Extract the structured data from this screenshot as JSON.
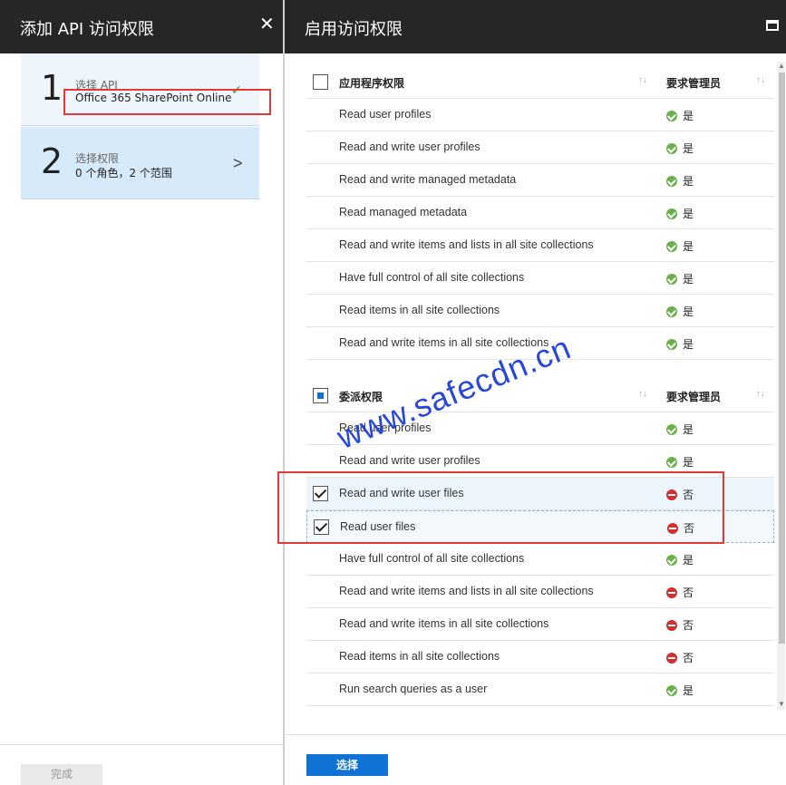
{
  "left_blade": {
    "title": "添加 API 访问权限",
    "close_icon": "close-icon",
    "steps": [
      {
        "number": "1",
        "label": "选择 API",
        "sub": "Office 365 SharePoint Online",
        "state": "completed"
      },
      {
        "number": "2",
        "label": "选择权限",
        "sub": "0 个角色，2 个范围",
        "state": "active"
      }
    ],
    "done_label": "完成"
  },
  "right_blade": {
    "title": "启用访问权限",
    "admin_header": "要求管理员",
    "app_group": {
      "name": "应用程序权限",
      "rows": [
        {
          "label": "Read user profiles",
          "admin": "是",
          "status": "yes"
        },
        {
          "label": "Read and write user profiles",
          "admin": "是",
          "status": "yes"
        },
        {
          "label": "Read and write managed metadata",
          "admin": "是",
          "status": "yes"
        },
        {
          "label": "Read managed metadata",
          "admin": "是",
          "status": "yes"
        },
        {
          "label": "Read and write items and lists in all site collections",
          "admin": "是",
          "status": "yes"
        },
        {
          "label": "Have full control of all site collections",
          "admin": "是",
          "status": "yes"
        },
        {
          "label": "Read items in all site collections",
          "admin": "是",
          "status": "yes"
        },
        {
          "label": "Read and write items in all site collections",
          "admin": "是",
          "status": "yes"
        }
      ]
    },
    "delegated_group": {
      "name": "委派权限",
      "rows": [
        {
          "label": "Read user profiles",
          "admin": "是",
          "status": "yes"
        },
        {
          "label": "Read and write user profiles",
          "admin": "是",
          "status": "yes"
        },
        {
          "label": "Read and write user files",
          "admin": "否",
          "status": "no",
          "checked": true
        },
        {
          "label": "Read user files",
          "admin": "否",
          "status": "no",
          "checked": true
        },
        {
          "label": "Have full control of all site collections",
          "admin": "是",
          "status": "yes"
        },
        {
          "label": "Read and write items and lists in all site collections",
          "admin": "否",
          "status": "no"
        },
        {
          "label": "Read and write items in all site collections",
          "admin": "否",
          "status": "no"
        },
        {
          "label": "Read items in all site collections",
          "admin": "否",
          "status": "no"
        },
        {
          "label": "Run search queries as a user",
          "admin": "是",
          "status": "yes"
        }
      ]
    },
    "select_label": "选择"
  },
  "watermark": "www.safecdn.cn",
  "colors": {
    "header_bg": "#262626",
    "primary_button": "#0f72d4",
    "yes_green": "#6ab04c",
    "no_red": "#d32f2f",
    "highlight_red": "#e53935"
  }
}
